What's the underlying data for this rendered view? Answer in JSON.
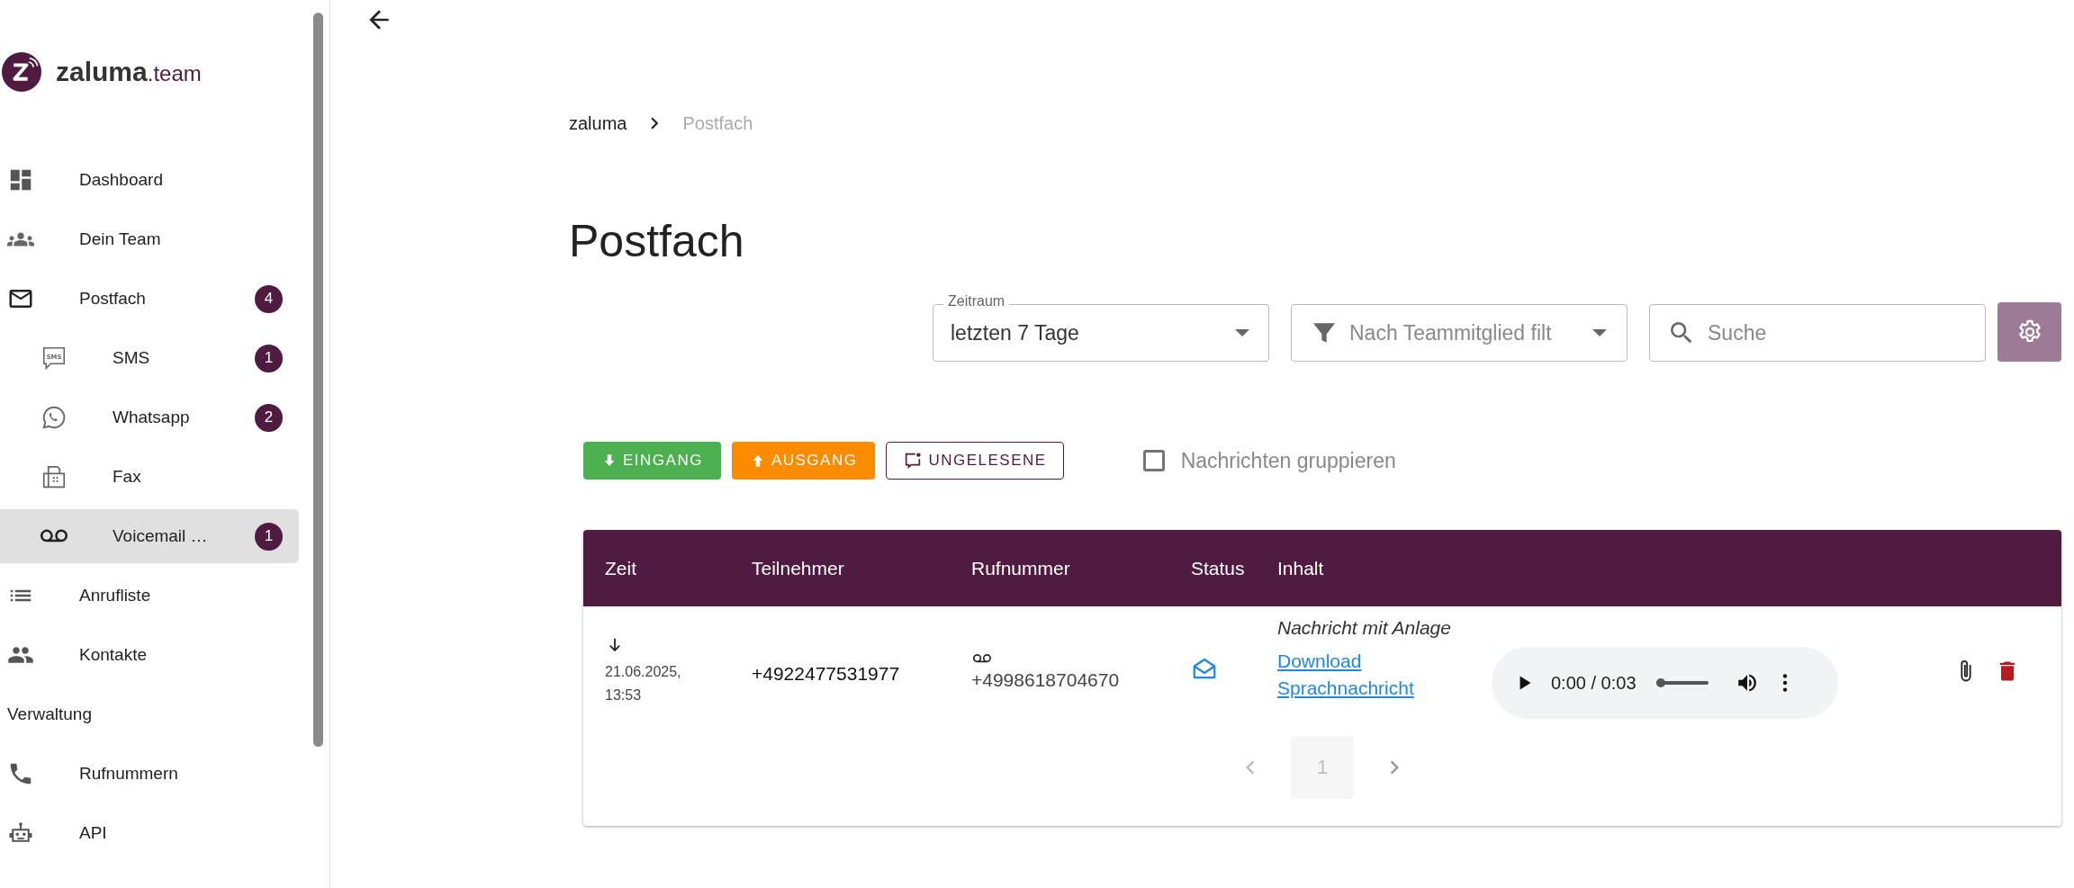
{
  "logo": {
    "name": "zaluma",
    "suffix": ".team"
  },
  "sidebar": {
    "items": [
      {
        "label": "Dashboard",
        "selected": false
      },
      {
        "label": "Dein Team",
        "selected": false
      },
      {
        "label": "Postfach",
        "badge": "4",
        "selected": false,
        "children": [
          {
            "label": "SMS",
            "icon_text": "SMS",
            "badge": "1",
            "selected": false
          },
          {
            "label": "Whatsapp",
            "badge": "2",
            "selected": false
          },
          {
            "label": "Fax",
            "selected": false
          },
          {
            "label": "Voicemail …",
            "badge": "1",
            "selected": true
          }
        ]
      },
      {
        "label": "Anrufliste",
        "selected": false
      },
      {
        "label": "Kontakte",
        "selected": false
      }
    ],
    "section": "Verwaltung",
    "admin_items": [
      {
        "label": "Rufnummern",
        "selected": false
      },
      {
        "label": "API",
        "selected": false
      }
    ]
  },
  "breadcrumb": [
    {
      "label": "zaluma",
      "current": false
    },
    {
      "label": "Postfach",
      "current": true
    }
  ],
  "title": "Postfach",
  "filters": {
    "period": {
      "label": "Zeitraum",
      "value": "letzten 7 Tage"
    },
    "member": {
      "placeholder": "Nach Teammitglied filt"
    },
    "search": {
      "placeholder": "Suche"
    }
  },
  "buttons": [
    {
      "label": "EINGANG",
      "kind": "incoming"
    },
    {
      "label": "AUSGANG",
      "kind": "outgoing"
    },
    {
      "label": "UNGELESENE",
      "kind": "unread"
    }
  ],
  "group_checkbox": {
    "label": "Nachrichten gruppieren",
    "checked": false
  },
  "table": {
    "columns": [
      "Zeit",
      "Teilnehmer",
      "Rufnummer",
      "Status",
      "Inhalt"
    ],
    "rows": [
      {
        "incoming": true,
        "datetime": "21.06.2025, 13:53",
        "participant": "+4922477531977",
        "number": "+4998618704670",
        "read": true,
        "content_title": "Nachricht mit Anlage",
        "link": "Download Sprachnachricht",
        "audio": {
          "time": "0:00 / 0:03",
          "level": 0
        }
      }
    ]
  },
  "pagination": {
    "pages": [
      {
        "label": "1",
        "selected": true
      }
    ]
  }
}
